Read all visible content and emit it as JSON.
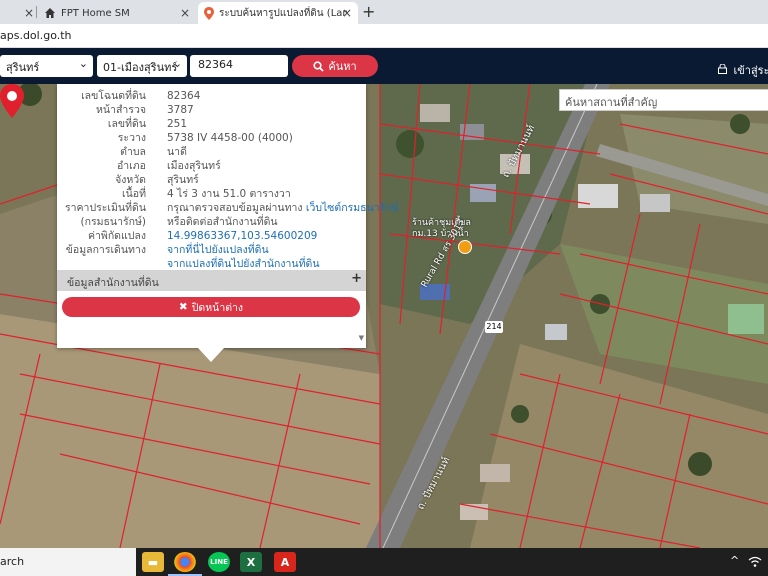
{
  "browser": {
    "tabs": [
      {
        "label": "",
        "close": "×"
      },
      {
        "label": "FPT Home SM",
        "close": "×"
      },
      {
        "label": "ระบบค้นหารูปแปลงที่ดิน (LandsMaps)",
        "close": "×"
      }
    ],
    "new_tab": "+",
    "url": "aps.dol.go.th"
  },
  "navbar": {
    "province": "สุรินทร์",
    "district": "01-เมืองสุรินทร์",
    "parcel_input": "82364",
    "search_label": "ค้นหา",
    "login_label": "เข้าสู่ระบบ"
  },
  "map": {
    "place_search_placeholder": "ค้นหาสถานที่สำคัญ",
    "poi_label": "ร้านค้าชุมเตี้ยล\nกม.13 บ้านน้ำ",
    "road_labels": [
      "ถ. ปัทมานนท์",
      "Rural Rd สร 3013",
      "ถ. ปัทมานนท์"
    ],
    "road_shield": "214"
  },
  "parcel_info": {
    "rows": [
      {
        "key": "เลขโฉนดที่ดิน",
        "value": "82364"
      },
      {
        "key": "หน้าสำรวจ",
        "value": "3787"
      },
      {
        "key": "เลขที่ดิน",
        "value": "251"
      },
      {
        "key": "ระวาง",
        "value": "5738 IV 4458-00 (4000)"
      },
      {
        "key": "ตำบล",
        "value": "นาดี"
      },
      {
        "key": "อำเภอ",
        "value": "เมืองสุรินทร์"
      },
      {
        "key": "จังหวัด",
        "value": "สุรินทร์"
      },
      {
        "key": "เนื้อที่",
        "value": "4 ไร่ 3 งาน 51.0 ตารางวา"
      }
    ],
    "price": {
      "key_line1": "ราคาประเมินที่ดิน",
      "key_line2": "(กรมธนารักษ์)",
      "value_prefix": "กรุณาตรวจสอบข้อมูลผ่านทาง",
      "value_link": "เว็บไซต์กรมธนารักษ์",
      "value_line2": "หรือติดต่อสำนักงานที่ดิน"
    },
    "coords": {
      "key": "ค่าพิกัดแปลง",
      "value": "14.99863367,103.54600209"
    },
    "travel": {
      "key": "ข้อมูลการเดินทาง",
      "link1": "จากที่นี่ไปยังแปลงที่ดิน",
      "link2": "จากแปลงที่ดินไปยังสำนักงานที่ดิน"
    },
    "office_section": "ข้อมูลสำนักงานที่ดิน",
    "office_toggle": "+",
    "close_label": "ปิดหน้าต่าง"
  },
  "taskbar": {
    "search_text": "arch",
    "tray_chevron": "^"
  },
  "colors": {
    "navbar": "#0a1a33",
    "accent_red": "#dc3545",
    "link_blue": "#1b6fb5",
    "parcel_line": "#e0202c"
  }
}
